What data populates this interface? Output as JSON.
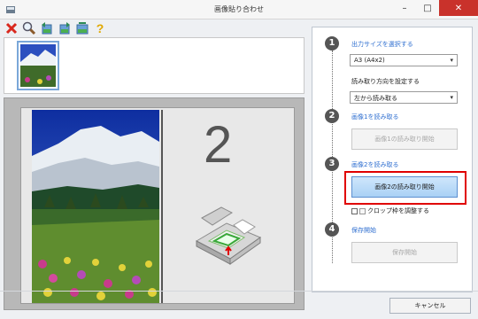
{
  "window": {
    "title": "画像貼り合わせ",
    "controls": {
      "minimize": "–",
      "maximize": "□",
      "close": "✕"
    }
  },
  "toolbar": {
    "icons": [
      "delete-icon",
      "zoom-icon",
      "rotate-left-icon",
      "rotate-right-icon",
      "swap-icon",
      "help-icon"
    ],
    "help_glyph": "?"
  },
  "preview": {
    "right_number": "2"
  },
  "steps": [
    {
      "num": "1",
      "title": "出力サイズを選択する"
    },
    {
      "num": "2",
      "title": "画像1を読み取る"
    },
    {
      "num": "3",
      "title": "画像2を読み取る"
    },
    {
      "num": "4",
      "title": "保存開始"
    }
  ],
  "output_size": {
    "selected": "A3 (A4x2)"
  },
  "scan_direction": {
    "label": "読み取り方向を設定する",
    "selected": "左から読み取る"
  },
  "buttons": {
    "scan1": "画像1の読み取り開始",
    "scan2": "画像2の読み取り開始",
    "save": "保存開始",
    "cancel": "キャンセル"
  },
  "crop_checkbox": {
    "label": "クロップ枠を調整する"
  },
  "colors": {
    "accent": "#2f6fd0",
    "highlight": "#e00000"
  }
}
